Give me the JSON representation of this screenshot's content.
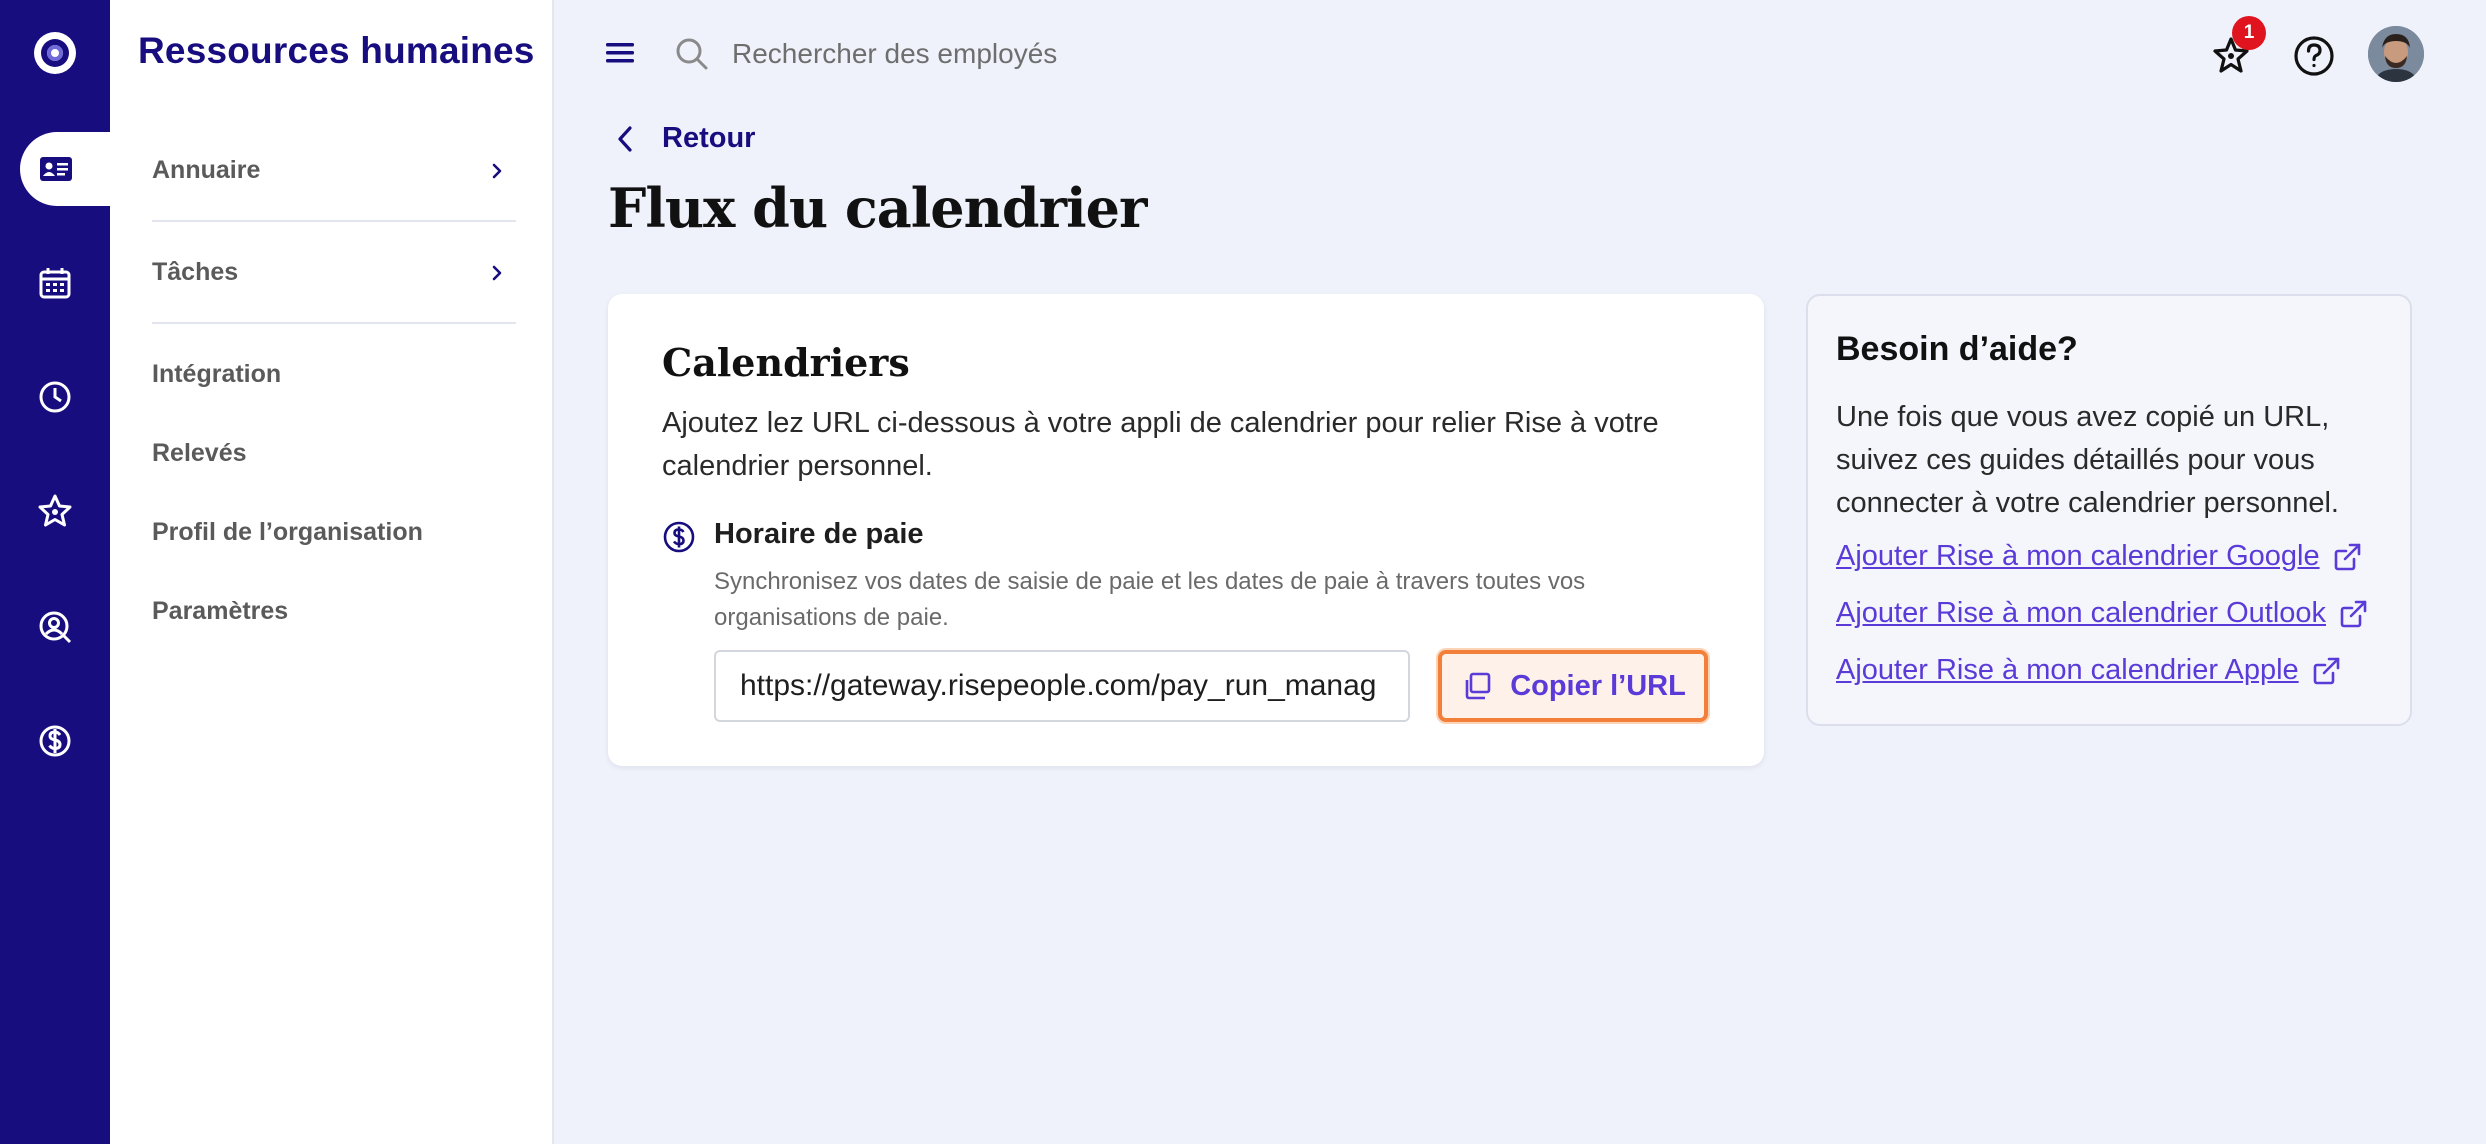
{
  "app": {
    "section_title": "Ressources humaines"
  },
  "rail": {
    "items": [
      {
        "icon": "contact-card-icon",
        "label": "Ressources humaines",
        "active": true
      },
      {
        "icon": "calendar-icon",
        "active": false
      },
      {
        "icon": "clock-icon",
        "active": false
      },
      {
        "icon": "star-icon",
        "active": false
      },
      {
        "icon": "person-search-icon",
        "active": false
      },
      {
        "icon": "dollar-circle-icon",
        "active": false
      }
    ]
  },
  "subnav": {
    "items": [
      {
        "label": "Annuaire",
        "has_chevron": true
      },
      {
        "label": "Tâches",
        "has_chevron": true
      },
      {
        "label": "Intégration"
      },
      {
        "label": "Relevés"
      },
      {
        "label": "Profil de l’organisation"
      },
      {
        "label": "Paramètres"
      }
    ]
  },
  "topbar": {
    "search_placeholder": "Rechercher des employés",
    "notification_count": "1"
  },
  "page": {
    "back_label": "Retour",
    "title": "Flux du calendrier"
  },
  "calendars": {
    "title": "Calendriers",
    "description": "Ajoutez lez URL ci-dessous à votre appli de calendrier pour relier Rise à votre calendrier personnel.",
    "feed": {
      "icon": "dollar-circle-icon",
      "title": "Horaire de paie",
      "description": "Synchronisez vos dates de saisie de paie et les dates de paie à travers toutes vos organisations de paie.",
      "url_value": "https://gateway.risepeople.com/pay_run_manag",
      "copy_label": "Copier l’URL"
    }
  },
  "help": {
    "title": "Besoin d’aide?",
    "text": "Une fois que vous avez copié un URL, suivez ces guides détaillés pour vous connecter à votre calendrier personnel.",
    "links": [
      {
        "label": "Ajouter Rise à mon calendrier Google",
        "icon": "external-link-icon"
      },
      {
        "label": "Ajouter Rise à mon calendrier Outlook",
        "icon": "external-link-icon"
      },
      {
        "label": "Ajouter Rise à mon calendrier Apple",
        "icon": "external-link-icon"
      }
    ]
  },
  "colors": {
    "brand_navy": "#170d7e",
    "link_purple": "#5b3bd8",
    "focus_orange": "#f27f3a",
    "badge_red": "#e0141e",
    "page_bg": "#eff2fb"
  }
}
